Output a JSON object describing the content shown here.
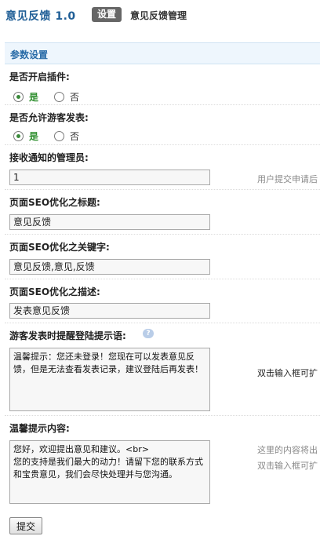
{
  "header": {
    "app_title": "意见反馈 1.0",
    "tab_settings": "设置",
    "manage_link": "意见反馈管理"
  },
  "section": {
    "title": "参数设置"
  },
  "fields": {
    "enable_plugin": {
      "label": "是否开启插件:",
      "yes": "是",
      "no": "否",
      "selected": "是"
    },
    "allow_guest": {
      "label": "是否允许游客发表:",
      "yes": "是",
      "no": "否",
      "selected": "是"
    },
    "admin": {
      "label": "接收通知的管理员:",
      "value": "1",
      "hint": "用户提交申请后"
    },
    "seo_title": {
      "label": "页面SEO优化之标题:",
      "value": "意见反馈"
    },
    "seo_keywords": {
      "label": "页面SEO优化之关键字:",
      "value": "意见反馈,意见,反馈"
    },
    "seo_description": {
      "label": "页面SEO优化之描述:",
      "value": "发表意见反馈"
    },
    "guest_login_tip": {
      "label": "游客发表时提醒登陆提示语:",
      "value": "温馨提示：您还未登录！您现在可以发表意见反馈，但是无法查看发表记录，建议登陆后再发表！",
      "hint": "双击输入框可扩"
    },
    "tip_content": {
      "label": "温馨提示内容:",
      "value": "您好，欢迎提出意见和建议。<br>\n您的支持是我们最大的动力！请留下您的联系方式和宝贵意见，我们会尽快处理并与您沟通。",
      "hint1": "这里的内容将出",
      "hint2": "双击输入框可扩"
    }
  },
  "submit_label": "提交"
}
